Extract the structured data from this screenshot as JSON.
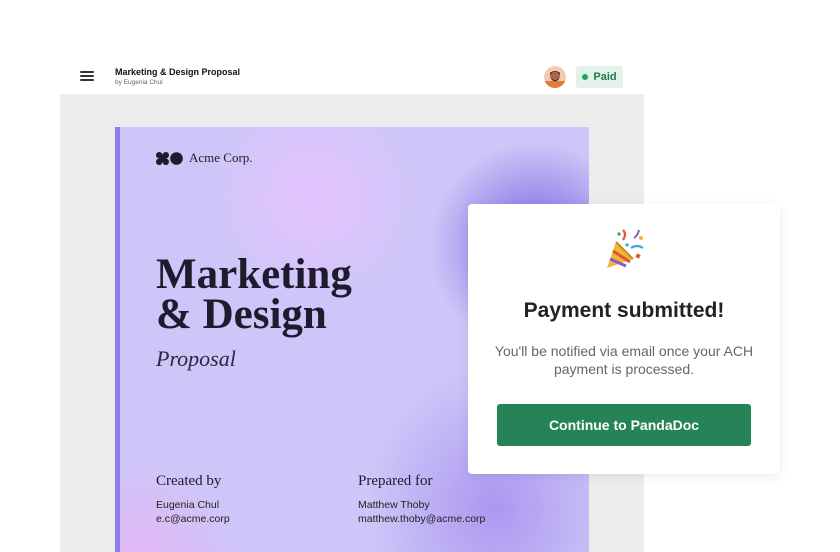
{
  "topbar": {
    "doc_title": "Marketing & Design Proposal",
    "doc_author": "by Eugenia Chul",
    "status_badge": "Paid",
    "status_color": "#26a15c"
  },
  "document": {
    "brand_name": "Acme Corp.",
    "title_line1": "Marketing",
    "title_line2": "& Design",
    "subtitle": "Proposal",
    "created_by": {
      "heading": "Created by",
      "name": "Eugenia Chul",
      "email": "e.c@acme.corp"
    },
    "prepared_for": {
      "heading": "Prepared for",
      "name": "Matthew Thoby",
      "email": "matthew.thoby@acme.corp"
    }
  },
  "modal": {
    "icon": "party-popper-icon",
    "title": "Payment submitted!",
    "body": "You'll be notified via email once your ACH payment is processed.",
    "button_label": "Continue to PandaDoc",
    "button_color": "#268358"
  }
}
